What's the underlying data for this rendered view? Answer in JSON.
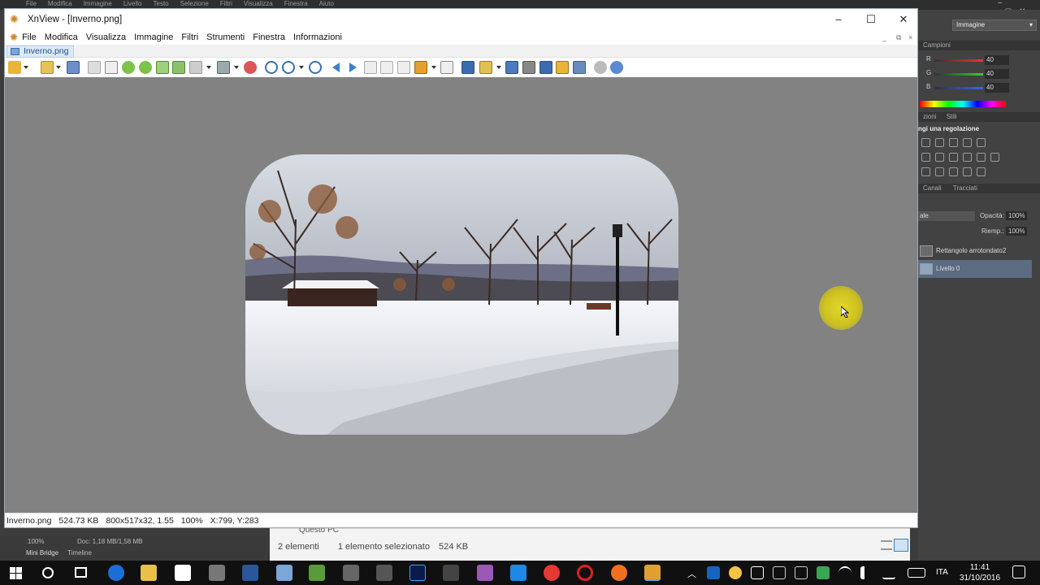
{
  "photoshop": {
    "menu": [
      "File",
      "Modifica",
      "Immagine",
      "Livello",
      "Testo",
      "Selezione",
      "Filtri",
      "Visualizza",
      "Finestra",
      "Aiuto"
    ],
    "workspace": "Immagine",
    "panel_campioni": "Campioni",
    "sliders": [
      {
        "label": "R",
        "value": "40"
      },
      {
        "label": "G",
        "value": "40"
      },
      {
        "label": "B",
        "value": "40"
      }
    ],
    "tabs_adjust": [
      "zioni",
      "Stili"
    ],
    "adjust_title": "ngi una regolazione",
    "tabs_layers": [
      "Canali",
      "Tracciati"
    ],
    "blend": "ale",
    "opacity_label": "Opacità:",
    "opacity_value": "100%",
    "fill_label": "Riemp.:",
    "fill_value": "100%",
    "layers": [
      "Rettangolo arrotondato2",
      "Livello 0"
    ],
    "bottom_zoom": "100%",
    "bottom_doc": "Doc: 1,18 MB/1,58 MB",
    "bottom_tabs": [
      "Mini Bridge",
      "Timeline"
    ]
  },
  "explorer": {
    "location": "Questo PC",
    "count": "2 elementi",
    "selected": "1 elemento selezionato",
    "size": "524 KB"
  },
  "xnview": {
    "title": "XnView - [Inverno.png]",
    "menu": [
      "File",
      "Modifica",
      "Visualizza",
      "Immagine",
      "Filtri",
      "Strumenti",
      "Finestra",
      "Informazioni"
    ],
    "tab": "Inverno.png",
    "status": {
      "filename": "Inverno.png",
      "filesize": "524.73 KB",
      "dims": "800x517x32, 1.55",
      "zoom": "100%",
      "coords": "X:799, Y:283"
    }
  },
  "taskbar": {
    "language": "ITA",
    "time": "11:41",
    "date": "31/10/2016"
  },
  "colors": {
    "viewer_bg": "#828282",
    "tab_bg": "#dce9f7",
    "taskbar_bg": "#101010",
    "highlight": "#e2d620"
  }
}
